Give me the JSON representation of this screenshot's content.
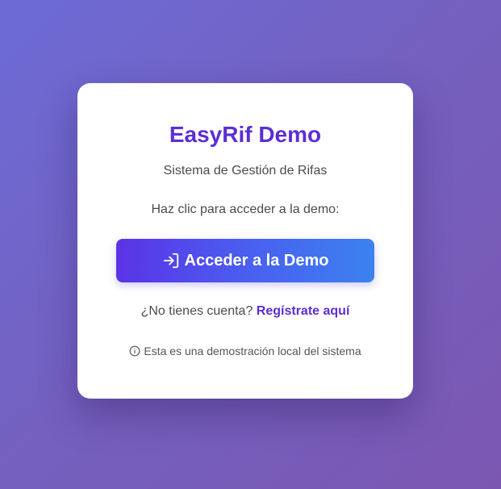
{
  "card": {
    "title": "EasyRif Demo",
    "subtitle": "Sistema de Gestión de Rifas",
    "prompt": "Haz clic para acceder a la demo:",
    "demo_button": {
      "label": "Acceder a la Demo",
      "icon": "sign-in-icon"
    },
    "register": {
      "question": "¿No tienes cuenta?",
      "link_label": "Regístrate aquí"
    },
    "note": {
      "icon": "info-circle-icon",
      "text": "Esta es una demostración local del sistema"
    }
  },
  "colors": {
    "accent": "#5b2ed6",
    "button_gradient_start": "#5b33e6",
    "button_gradient_end": "#3b82f0",
    "background_start": "#6c6bd6",
    "background_end": "#7b57b2"
  }
}
